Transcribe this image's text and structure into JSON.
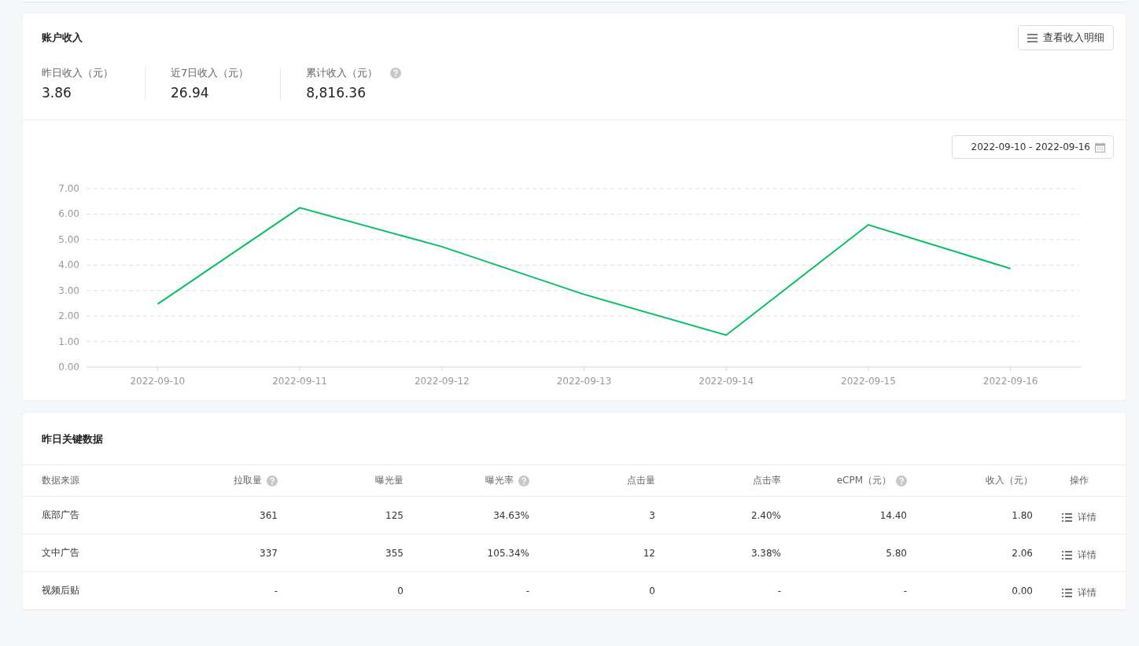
{
  "income": {
    "title": "账户收入",
    "detail_button": "查看收入明细",
    "stats": [
      {
        "label": "昨日收入（元）",
        "value": "3.86",
        "help": false
      },
      {
        "label": "近7日收入（元）",
        "value": "26.94",
        "help": false
      },
      {
        "label": "累计收入（元）",
        "value": "8,816.36",
        "help": true
      }
    ],
    "date_range": "2022-09-10 - 2022-09-16",
    "chart_data": {
      "type": "line",
      "categories": [
        "2022-09-10",
        "2022-09-11",
        "2022-09-12",
        "2022-09-13",
        "2022-09-14",
        "2022-09-15",
        "2022-09-16"
      ],
      "grid": true,
      "series": [
        {
          "color": "#07c160",
          "values": [
            2.47,
            6.25,
            4.72,
            2.85,
            1.25,
            5.58,
            3.86
          ]
        }
      ],
      "ylim": [
        0,
        7
      ],
      "yticks": [
        {
          "value": 0,
          "label": "0.00"
        },
        {
          "value": 1,
          "label": "1.00"
        },
        {
          "value": 2,
          "label": "2.00"
        },
        {
          "value": 3,
          "label": "3.00"
        },
        {
          "value": 4,
          "label": "4.00"
        },
        {
          "value": 5,
          "label": "5.00"
        },
        {
          "value": 6,
          "label": "6.00"
        },
        {
          "value": 7,
          "label": "7.00"
        }
      ]
    }
  },
  "key_data": {
    "title": "昨日关键数据",
    "columns": [
      {
        "label": "数据来源",
        "help": false
      },
      {
        "label": "拉取量",
        "help": true
      },
      {
        "label": "曝光量",
        "help": false
      },
      {
        "label": "曝光率",
        "help": true
      },
      {
        "label": "点击量",
        "help": false
      },
      {
        "label": "点击率",
        "help": false
      },
      {
        "label": "eCPM（元）",
        "help": true
      },
      {
        "label": "收入（元）",
        "help": false
      },
      {
        "label": "操作",
        "help": false
      }
    ],
    "rows": [
      {
        "cells": [
          "底部广告",
          "361",
          "125",
          "34.63%",
          "3",
          "2.40%",
          "14.40",
          "1.80"
        ],
        "action": "详情"
      },
      {
        "cells": [
          "文中广告",
          "337",
          "355",
          "105.34%",
          "12",
          "3.38%",
          "5.80",
          "2.06"
        ],
        "action": "详情"
      },
      {
        "cells": [
          "视频后贴",
          "-",
          "0",
          "-",
          "0",
          "-",
          "-",
          "0.00"
        ],
        "action": "详情"
      }
    ]
  }
}
